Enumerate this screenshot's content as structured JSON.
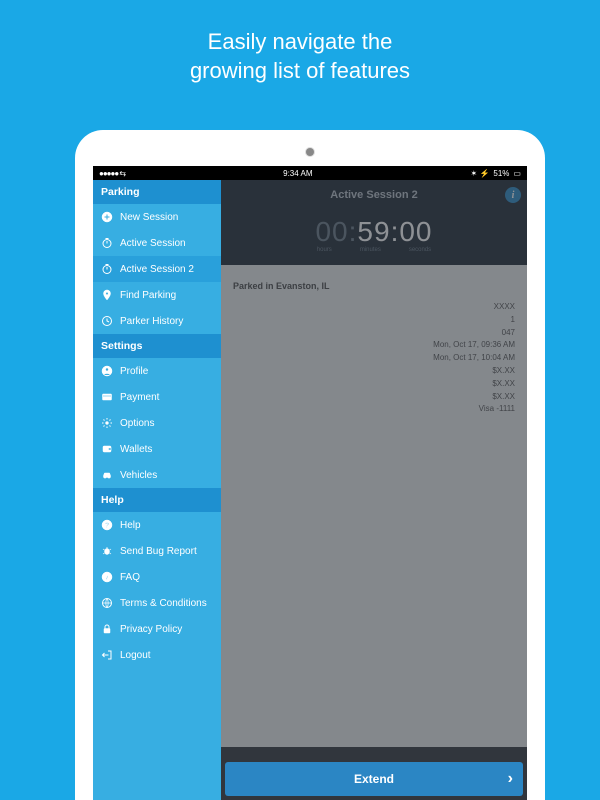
{
  "headline_line1": "Easily navigate the",
  "headline_line2": "growing list of features",
  "statusbar": {
    "time": "9:34 AM",
    "battery": "51%"
  },
  "sidebar": {
    "sections": {
      "parking": "Parking",
      "settings": "Settings",
      "help": "Help"
    },
    "items": {
      "new_session": "New Session",
      "active_session": "Active Session",
      "active_session_2": "Active Session 2",
      "find_parking": "Find Parking",
      "parker_history": "Parker History",
      "profile": "Profile",
      "payment": "Payment",
      "options": "Options",
      "wallets": "Wallets",
      "vehicles": "Vehicles",
      "help": "Help",
      "send_bug": "Send Bug Report",
      "faq": "FAQ",
      "terms": "Terms & Conditions",
      "privacy": "Privacy Policy",
      "logout": "Logout"
    }
  },
  "main": {
    "title": "Active Session 2",
    "timer": {
      "hours": "00",
      "minutes": "59",
      "seconds": "00",
      "lbl_h": "hours",
      "lbl_m": "minutes",
      "lbl_s": "seconds"
    },
    "location": "Parked in Evanston, IL",
    "details": {
      "l1": "XXXX",
      "l2": "1",
      "l3": "047",
      "l4": "Mon, Oct 17, 09:36 AM",
      "l5": "Mon, Oct 17, 10:04 AM",
      "l6": "$X.XX",
      "l7": "$X.XX",
      "l8": "$X.XX",
      "l9": "Visa -1111"
    },
    "extend": "Extend",
    "info": "i"
  }
}
